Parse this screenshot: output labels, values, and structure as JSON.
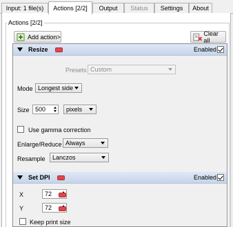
{
  "tabs": [
    {
      "label": "Input: 1 file(s)"
    },
    {
      "label": "Actions [2/2]"
    },
    {
      "label": "Output"
    },
    {
      "label": "Status"
    },
    {
      "label": "Settings"
    },
    {
      "label": "About"
    }
  ],
  "group_title": "Actions [2/2]",
  "toolbar": {
    "add_action": "Add action>",
    "clear_all": "Clear all"
  },
  "resize": {
    "title": "Resize",
    "enabled_label": "Enabled",
    "enabled": true,
    "presets_label": "Presets",
    "presets_value": "Custom",
    "mode_label": "Mode",
    "mode_value": "Longest side",
    "size_label": "Size",
    "size_value": "500",
    "unit_value": "pixels",
    "gamma_label": "Use gamma correction",
    "gamma_checked": false,
    "enlarge_label": "Enlarge/Reduce",
    "enlarge_value": "Always",
    "resample_label": "Resample",
    "resample_value": "Lanczos"
  },
  "set_dpi": {
    "title": "Set DPI",
    "enabled_label": "Enabled",
    "enabled": true,
    "x_label": "X",
    "x_value": "72",
    "y_label": "Y",
    "y_value": "72",
    "keep_print_label": "Keep print size",
    "keep_print_checked": false
  },
  "colors": {
    "header_bg": "#c6d4ea",
    "remove_red": "#e0484e",
    "tab_border": "#aeb3b9"
  }
}
